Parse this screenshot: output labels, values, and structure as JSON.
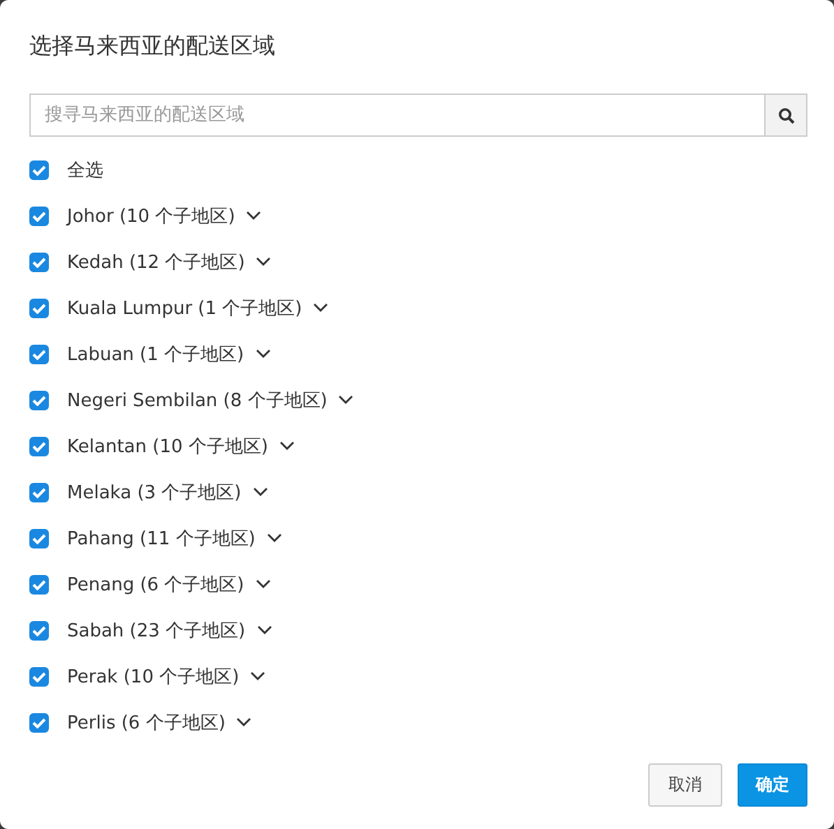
{
  "dialog": {
    "title": "选择马来西亚的配送区域"
  },
  "search": {
    "placeholder": "搜寻马来西亚的配送区域"
  },
  "select_all": {
    "label": "全选",
    "checked": true
  },
  "regions": [
    {
      "label": "Johor (10 个子地区)",
      "checked": true,
      "expanded": false
    },
    {
      "label": "Kedah (12 个子地区)",
      "checked": true,
      "expanded": false
    },
    {
      "label": "Kuala Lumpur (1 个子地区)",
      "checked": true,
      "expanded": false
    },
    {
      "label": "Labuan (1 个子地区)",
      "checked": true,
      "expanded": false
    },
    {
      "label": "Negeri Sembilan (8 个子地区)",
      "checked": true,
      "expanded": false
    },
    {
      "label": "Kelantan (10 个子地区)",
      "checked": true,
      "expanded": false
    },
    {
      "label": "Melaka (3 个子地区)",
      "checked": true,
      "expanded": false
    },
    {
      "label": "Pahang (11 个子地区)",
      "checked": true,
      "expanded": false
    },
    {
      "label": "Penang (6 个子地区)",
      "checked": true,
      "expanded": false
    },
    {
      "label": "Sabah (23 个子地区)",
      "checked": true,
      "expanded": false
    },
    {
      "label": "Perak (10 个子地区)",
      "checked": true,
      "expanded": false
    },
    {
      "label": "Perlis (6 个子地区)",
      "checked": true,
      "expanded": false
    }
  ],
  "buttons": [
    {
      "label": "取消",
      "kind": "secondary"
    },
    {
      "label": "确定",
      "kind": "primary"
    }
  ]
}
